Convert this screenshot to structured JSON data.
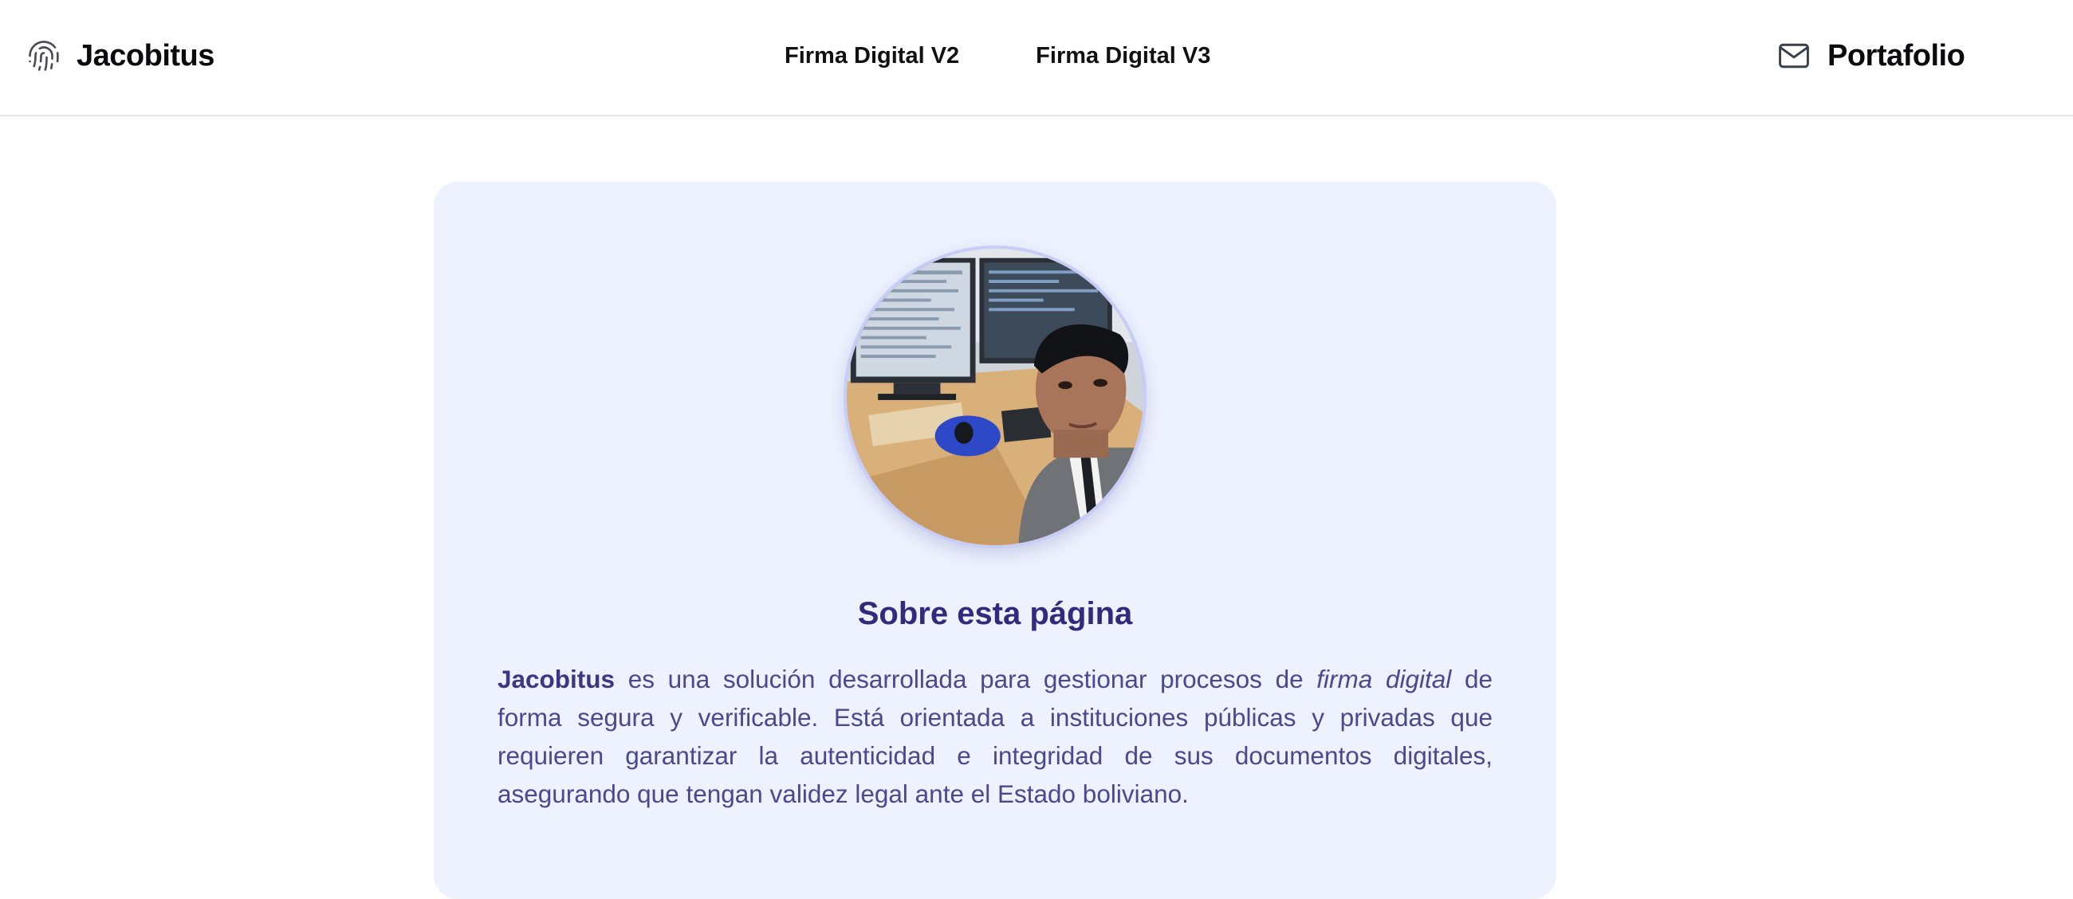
{
  "header": {
    "brand": {
      "icon": "fingerprint-icon",
      "name": "Jacobitus"
    },
    "nav": [
      {
        "label": "Firma Digital V2"
      },
      {
        "label": "Firma Digital V3"
      }
    ],
    "portfolio": {
      "icon": "mail-icon",
      "label": "Portafolio"
    }
  },
  "about": {
    "avatar": "profile-photo",
    "title": "Sobre esta página",
    "paragraph": {
      "brand": "Jacobitus",
      "part1": " es una solución desarrollada para gestionar procesos de ",
      "emphasis": "firma digital",
      "part2": " de forma segura y verificable. Está orientada a instituciones públicas y privadas que requieren garantizar la autenticidad e integridad de sus documentos digitales, asegurando que tengan validez legal ante el Estado boliviano."
    }
  },
  "colors": {
    "card_background": "#eef2fe",
    "title": "#312a7d",
    "body_text": "#4b4791"
  }
}
